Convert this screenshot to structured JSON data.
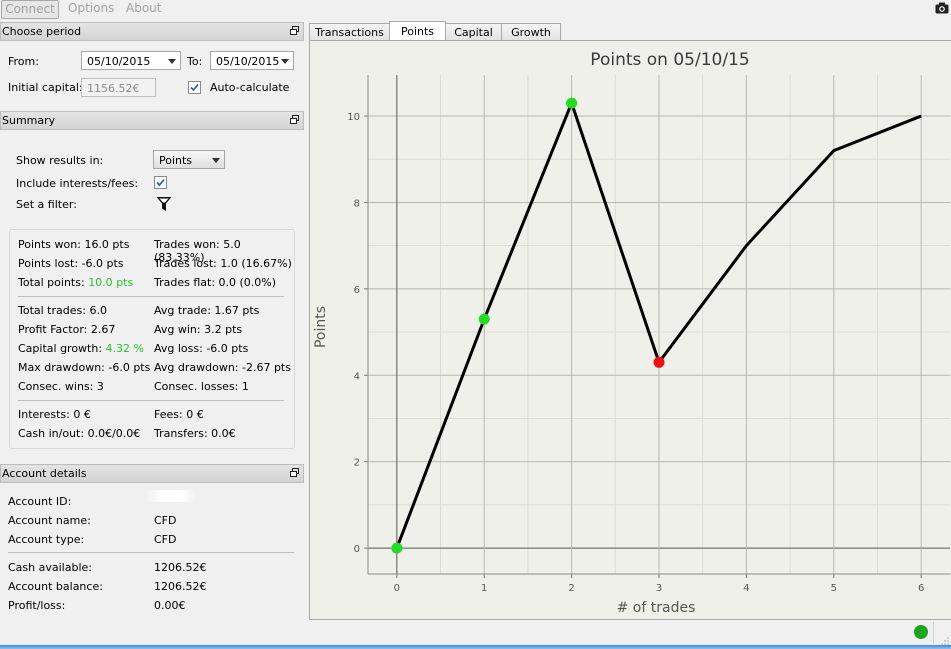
{
  "menu": {
    "connect": "Connect",
    "options": "Options",
    "about": "About"
  },
  "period": {
    "header": "Choose period",
    "from_label": "From:",
    "from_value": "05/10/2015",
    "to_label": "To:",
    "to_value": "05/10/2015",
    "capital_label": "Initial capital:",
    "capital_value": "1156.52€",
    "auto_label": "Auto-calculate",
    "auto_checked": true
  },
  "summary": {
    "header": "Summary",
    "show_results_label": "Show results in:",
    "show_results_value": "Points",
    "include_fees_label": "Include interests/fees:",
    "include_fees_checked": true,
    "filter_label": "Set a filter:",
    "points_won": "Points won: 16.0 pts",
    "points_lost": "Points lost: -6.0 pts",
    "total_points_label": "Total points:",
    "total_points_value": "10.0 pts",
    "trades_won": "Trades won: 5.0 (83.33%)",
    "trades_lost": "Trades lost: 1.0 (16.67%)",
    "trades_flat": "Trades flat: 0.0 (0.0%)",
    "total_trades": "Total trades: 6.0",
    "profit_factor": "Profit Factor: 2.67",
    "capital_growth_label": "Capital growth:",
    "capital_growth_value": "4.32 %",
    "max_drawdown": "Max drawdown: -6.0 pts",
    "consec_wins": "Consec. wins: 3",
    "avg_trade": "Avg trade: 1.67 pts",
    "avg_win": "Avg win: 3.2 pts",
    "avg_loss": "Avg loss: -6.0 pts",
    "avg_drawdown": "Avg drawdown: -2.67 pts",
    "consec_losses": "Consec. losses: 1",
    "interests": "Interests: 0 €",
    "cash_inout": "Cash in/out: 0.0€/0.0€",
    "fees": "Fees: 0 €",
    "transfers": "Transfers: 0.0€"
  },
  "account": {
    "header": "Account details",
    "id_label": "Account ID:",
    "name_label": "Account name:",
    "name_value": "CFD",
    "type_label": "Account type:",
    "type_value": "CFD",
    "cash_label": "Cash available:",
    "cash_value": "1206.52€",
    "balance_label": "Account balance:",
    "balance_value": "1206.52€",
    "pl_label": "Profit/loss:",
    "pl_value": "0.00€"
  },
  "tabs": [
    "Transactions",
    "Points",
    "Capital",
    "Growth"
  ],
  "active_tab": "Points",
  "colors": {
    "green": "#2cc52c",
    "win_marker": "#22dd22",
    "loss_marker": "#ee1111",
    "status": "#1aa51a"
  },
  "chart_data": {
    "type": "line",
    "title": "Points on 05/10/15",
    "xlabel": "# of trades",
    "ylabel": "Points",
    "x": [
      0,
      1,
      2,
      3,
      4,
      5,
      6
    ],
    "y": [
      0,
      5.3,
      10.3,
      4.3,
      7.0,
      9.2,
      10.0
    ],
    "markers": [
      {
        "x": 0,
        "y": 0,
        "color": "green"
      },
      {
        "x": 1,
        "y": 5.3,
        "color": "green"
      },
      {
        "x": 2,
        "y": 10.3,
        "color": "green"
      },
      {
        "x": 3,
        "y": 4.3,
        "color": "red"
      }
    ],
    "xlim": [
      -0.33,
      6.33
    ],
    "ylim": [
      -0.6,
      10.95
    ],
    "xticks": [
      0,
      1,
      2,
      3,
      4,
      5,
      6
    ],
    "yticks": [
      0,
      2,
      4,
      6,
      8,
      10
    ],
    "grid": true
  }
}
